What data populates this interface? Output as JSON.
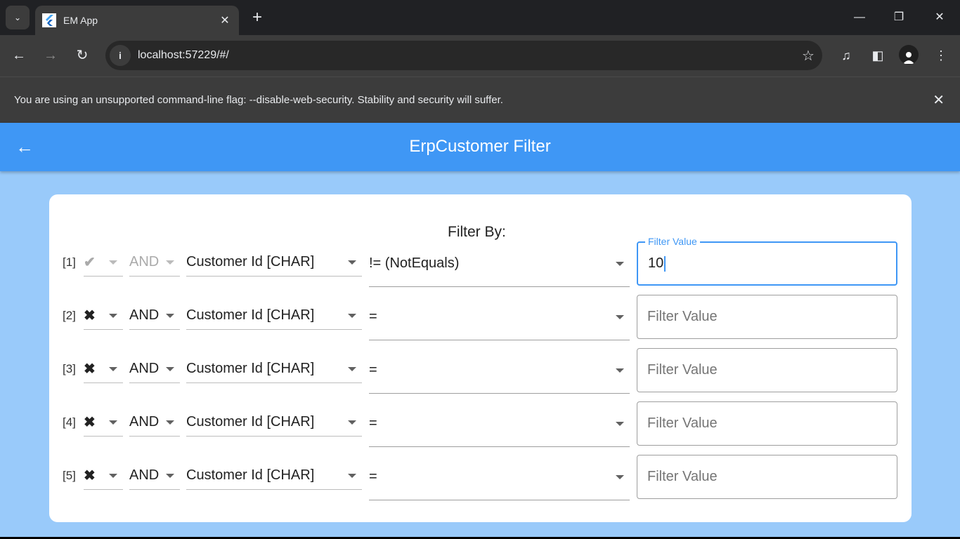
{
  "browser": {
    "tab_title": "EM App",
    "url": "localhost:57229/#/",
    "infobar_text": "You are using an unsupported command-line flag: --disable-web-security. Stability and security will suffer."
  },
  "app": {
    "title": "ErpCustomer Filter",
    "filter_by_label": "Filter By:",
    "filter_value_label": "Filter Value",
    "filter_value_placeholder": "Filter Value",
    "rows": [
      {
        "index": "[1]",
        "enabled_mark": "✔",
        "logic": "AND",
        "field": "Customer Id [CHAR]",
        "operator": "!= (NotEquals)",
        "value": "10"
      },
      {
        "index": "[2]",
        "enabled_mark": "✖",
        "logic": "AND",
        "field": "Customer Id [CHAR]",
        "operator": "=",
        "value": ""
      },
      {
        "index": "[3]",
        "enabled_mark": "✖",
        "logic": "AND",
        "field": "Customer Id [CHAR]",
        "operator": "=",
        "value": ""
      },
      {
        "index": "[4]",
        "enabled_mark": "✖",
        "logic": "AND",
        "field": "Customer Id [CHAR]",
        "operator": "=",
        "value": ""
      },
      {
        "index": "[5]",
        "enabled_mark": "✖",
        "logic": "AND",
        "field": "Customer Id [CHAR]",
        "operator": "=",
        "value": ""
      }
    ]
  }
}
